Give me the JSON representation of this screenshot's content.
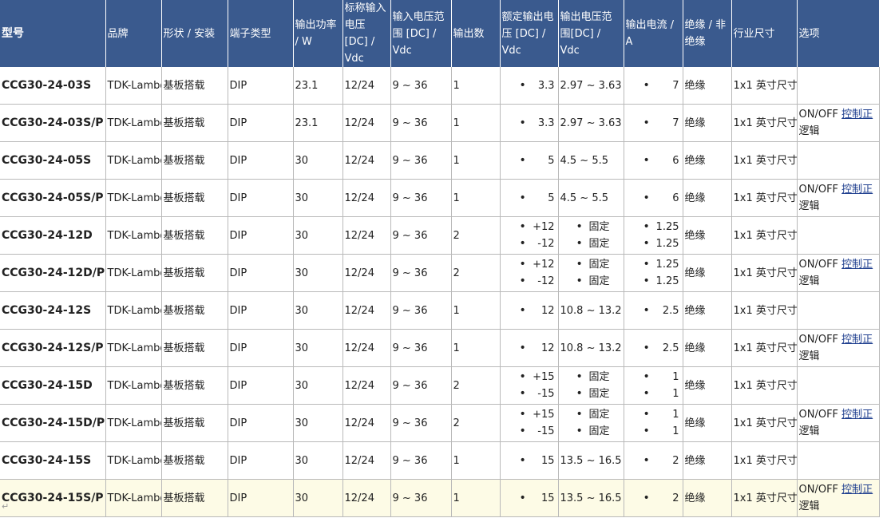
{
  "headers": [
    "型号",
    "品牌",
    "形状 / 安装",
    "端子类型",
    "输出功率 / W",
    "标称输入电压[DC] / Vdc",
    "输入电压范围 [DC] / Vdc",
    "输出数",
    "额定输出电压 [DC] / Vdc",
    "输出电压范围[DC] / Vdc",
    "输出电流 / A",
    "绝缘 / 非绝缘",
    "行业尺寸",
    "选项"
  ],
  "option_text": "ON/OFF",
  "option_link": "控制正",
  "option_text2": "逻辑",
  "rows": [
    {
      "model": "CCG30-24-03S",
      "brand": "TDK-Lambda",
      "mount": "基板搭载",
      "term": "DIP",
      "power": "23.1",
      "vin": "12/24",
      "vrange": "9 ~ 36",
      "outputs": "1",
      "vout": [
        "3.3"
      ],
      "vorange": [
        "2.97 ~ 3.63"
      ],
      "iout": [
        "7"
      ],
      "iso": "绝缘",
      "size": "1x1 英寸尺寸",
      "option": false
    },
    {
      "model": "CCG30-24-03S/P",
      "brand": "TDK-Lambda",
      "mount": "基板搭载",
      "term": "DIP",
      "power": "23.1",
      "vin": "12/24",
      "vrange": "9 ~ 36",
      "outputs": "1",
      "vout": [
        "3.3"
      ],
      "vorange": [
        "2.97 ~ 3.63"
      ],
      "iout": [
        "7"
      ],
      "iso": "绝缘",
      "size": "1x1 英寸尺寸",
      "option": true
    },
    {
      "model": "CCG30-24-05S",
      "brand": "TDK-Lambda",
      "mount": "基板搭载",
      "term": "DIP",
      "power": "30",
      "vin": "12/24",
      "vrange": "9 ~ 36",
      "outputs": "1",
      "vout": [
        "5"
      ],
      "vorange": [
        "4.5 ~ 5.5"
      ],
      "iout": [
        "6"
      ],
      "iso": "绝缘",
      "size": "1x1 英寸尺寸",
      "option": false
    },
    {
      "model": "CCG30-24-05S/P",
      "brand": "TDK-Lambda",
      "mount": "基板搭载",
      "term": "DIP",
      "power": "30",
      "vin": "12/24",
      "vrange": "9 ~ 36",
      "outputs": "1",
      "vout": [
        "5"
      ],
      "vorange": [
        "4.5 ~ 5.5"
      ],
      "iout": [
        "6"
      ],
      "iso": "绝缘",
      "size": "1x1 英寸尺寸",
      "option": true
    },
    {
      "model": "CCG30-24-12D",
      "brand": "TDK-Lambda",
      "mount": "基板搭载",
      "term": "DIP",
      "power": "30",
      "vin": "12/24",
      "vrange": "9 ~ 36",
      "outputs": "2",
      "vout": [
        "+12",
        "-12"
      ],
      "vorange": [
        "固定",
        "固定"
      ],
      "iout": [
        "1.25",
        "1.25"
      ],
      "iso": "绝缘",
      "size": "1x1 英寸尺寸",
      "option": false
    },
    {
      "model": "CCG30-24-12D/P",
      "brand": "TDK-Lambda",
      "mount": "基板搭载",
      "term": "DIP",
      "power": "30",
      "vin": "12/24",
      "vrange": "9 ~ 36",
      "outputs": "2",
      "vout": [
        "+12",
        "-12"
      ],
      "vorange": [
        "固定",
        "固定"
      ],
      "iout": [
        "1.25",
        "1.25"
      ],
      "iso": "绝缘",
      "size": "1x1 英寸尺寸",
      "option": true
    },
    {
      "model": "CCG30-24-12S",
      "brand": "TDK-Lambda",
      "mount": "基板搭载",
      "term": "DIP",
      "power": "30",
      "vin": "12/24",
      "vrange": "9 ~ 36",
      "outputs": "1",
      "vout": [
        "12"
      ],
      "vorange": [
        "10.8 ~ 13.2"
      ],
      "iout": [
        "2.5"
      ],
      "iso": "绝缘",
      "size": "1x1 英寸尺寸",
      "option": false
    },
    {
      "model": "CCG30-24-12S/P",
      "brand": "TDK-Lambda",
      "mount": "基板搭载",
      "term": "DIP",
      "power": "30",
      "vin": "12/24",
      "vrange": "9 ~ 36",
      "outputs": "1",
      "vout": [
        "12"
      ],
      "vorange": [
        "10.8 ~ 13.2"
      ],
      "iout": [
        "2.5"
      ],
      "iso": "绝缘",
      "size": "1x1 英寸尺寸",
      "option": true
    },
    {
      "model": "CCG30-24-15D",
      "brand": "TDK-Lambda",
      "mount": "基板搭载",
      "term": "DIP",
      "power": "30",
      "vin": "12/24",
      "vrange": "9 ~ 36",
      "outputs": "2",
      "vout": [
        "+15",
        "-15"
      ],
      "vorange": [
        "固定",
        "固定"
      ],
      "iout": [
        "1",
        "1"
      ],
      "iso": "绝缘",
      "size": "1x1 英寸尺寸",
      "option": false
    },
    {
      "model": "CCG30-24-15D/P",
      "brand": "TDK-Lambda",
      "mount": "基板搭载",
      "term": "DIP",
      "power": "30",
      "vin": "12/24",
      "vrange": "9 ~ 36",
      "outputs": "2",
      "vout": [
        "+15",
        "-15"
      ],
      "vorange": [
        "固定",
        "固定"
      ],
      "iout": [
        "1",
        "1"
      ],
      "iso": "绝缘",
      "size": "1x1 英寸尺寸",
      "option": true
    },
    {
      "model": "CCG30-24-15S",
      "brand": "TDK-Lambda",
      "mount": "基板搭载",
      "term": "DIP",
      "power": "30",
      "vin": "12/24",
      "vrange": "9 ~ 36",
      "outputs": "1",
      "vout": [
        "15"
      ],
      "vorange": [
        "13.5 ~ 16.5"
      ],
      "iout": [
        "2"
      ],
      "iso": "绝缘",
      "size": "1x1 英寸尺寸",
      "option": false
    },
    {
      "model": "CCG30-24-15S/P",
      "brand": "TDK-Lambda",
      "mount": "基板搭载",
      "term": "DIP",
      "power": "30",
      "vin": "12/24",
      "vrange": "9 ~ 36",
      "outputs": "1",
      "vout": [
        "15"
      ],
      "vorange": [
        "13.5 ~ 16.5"
      ],
      "iout": [
        "2"
      ],
      "iso": "绝缘",
      "size": "1x1 英寸尺寸",
      "option": true,
      "highlight": true
    }
  ]
}
